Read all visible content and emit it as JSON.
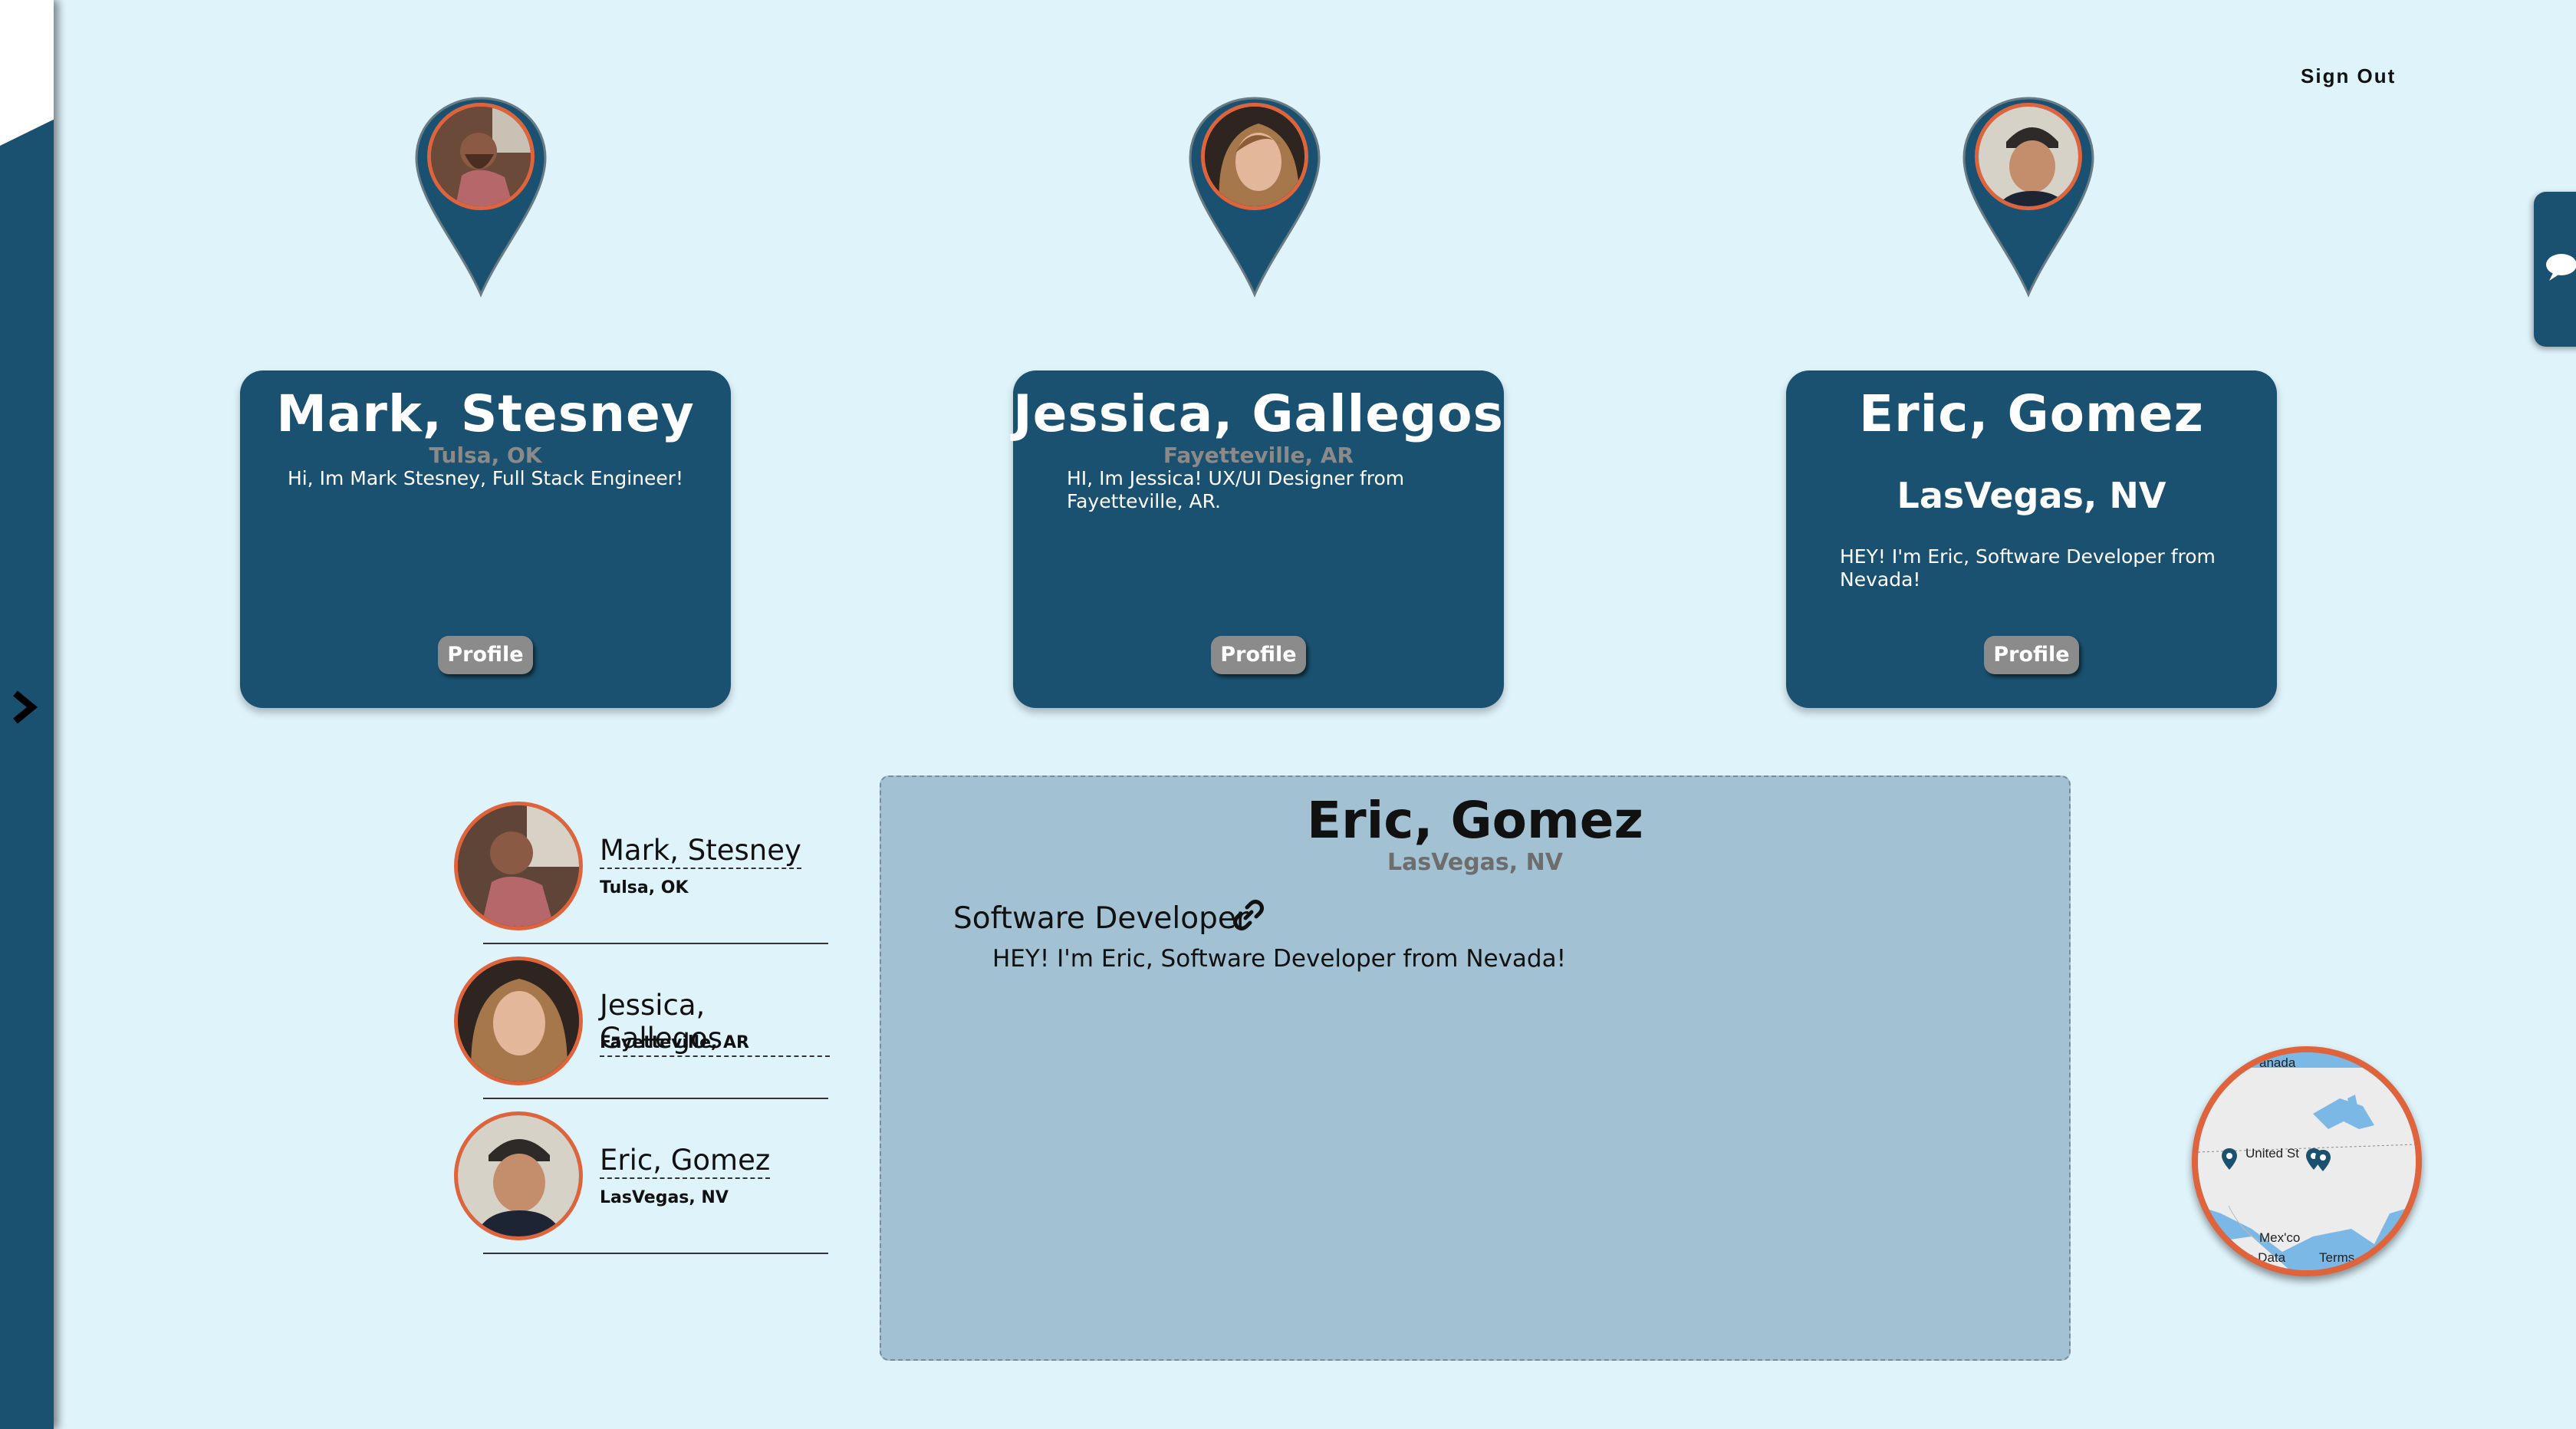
{
  "header": {
    "sign_out_label": "Sign Out"
  },
  "sidebar": {
    "toggle_icon": "chevron-right-icon"
  },
  "chat": {
    "icon": "chat-bubble-icon"
  },
  "colors": {
    "accent": "#1a5170",
    "background": "#dff3fb",
    "highlight": "#e0643b",
    "detail_bg": "#a2c2d3",
    "button": "#8b8b8b"
  },
  "cards": [
    {
      "name": "Mark, Stesney",
      "location": "Tulsa, OK",
      "bio": "Hi, Im Mark Stesney, Full Stack Engineer!",
      "button_label": "Profile"
    },
    {
      "name": "Jessica, Gallegos",
      "location": "Fayetteville, AR",
      "bio": "HI, Im Jessica! UX/UI Designer from Fayetteville, AR.",
      "button_label": "Profile"
    },
    {
      "name": "Eric, Gomez",
      "location": "LasVegas, NV",
      "bio": "HEY! I'm Eric, Software Developer from Nevada!",
      "button_label": "Profile"
    }
  ],
  "list": [
    {
      "name": "Mark, Stesney",
      "location": "Tulsa, OK"
    },
    {
      "name": "Jessica, Gallegos",
      "location": "Fayetteville, AR"
    },
    {
      "name": "Eric, Gomez",
      "location": "LasVegas, NV"
    }
  ],
  "detail": {
    "name": "Eric, Gomez",
    "location": "LasVegas, NV",
    "role": "Software Developer",
    "bio": "HEY! I'm Eric, Software Developer from Nevada!"
  },
  "map": {
    "labels": {
      "canada": "anada",
      "us": "United St",
      "mexico": "Mex'co",
      "data": "a Data",
      "terms": "Terms"
    }
  }
}
